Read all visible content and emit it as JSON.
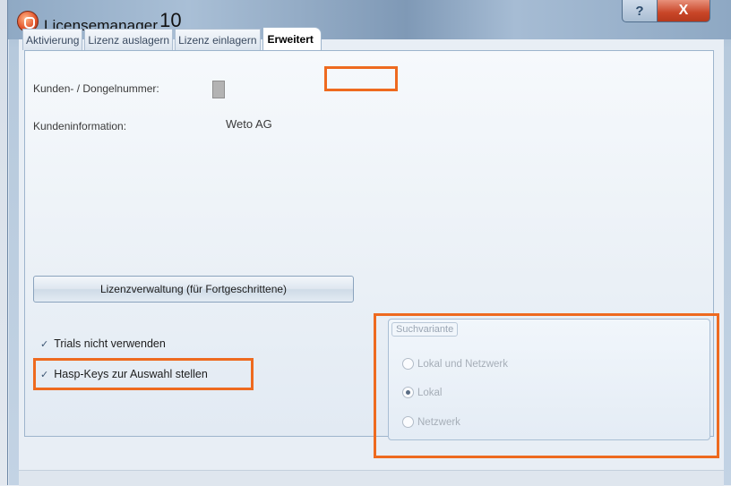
{
  "window": {
    "title": "Licensemanager",
    "title_number": "10",
    "help_label": "?",
    "close_label": "X"
  },
  "tabs": [
    {
      "label": "Aktivierung"
    },
    {
      "label": "Lizenz auslagern"
    },
    {
      "label": "Lizenz einlagern"
    },
    {
      "label": "Erweitert",
      "active": true
    }
  ],
  "info": {
    "customer_label": "Kunden- / Dongelnummer:",
    "customer_info_label": "Kundeninformation:",
    "customer_info_value": "Weto AG"
  },
  "buttons": {
    "license_admin": "Lizenzverwaltung (für Fortgeschrittene)"
  },
  "checkboxes": [
    {
      "label": "Trials nicht verwenden",
      "checked": true
    },
    {
      "label": "Hasp-Keys zur Auswahl stellen",
      "checked": true
    }
  ],
  "search_group": {
    "legend": "Suchvariante",
    "options": [
      {
        "label": "Lokal und Netzwerk",
        "selected": false
      },
      {
        "label": "Lokal",
        "selected": true
      },
      {
        "label": "Netzwerk",
        "selected": false
      }
    ],
    "enabled": false
  },
  "colors": {
    "highlight": "#ee6a1f",
    "titlebar": "#8fa9c4",
    "close_button": "#c84527"
  },
  "icons": {
    "app": "licensemanager-app-icon",
    "check": "checkmark-icon",
    "help": "help-icon",
    "close": "close-icon"
  }
}
